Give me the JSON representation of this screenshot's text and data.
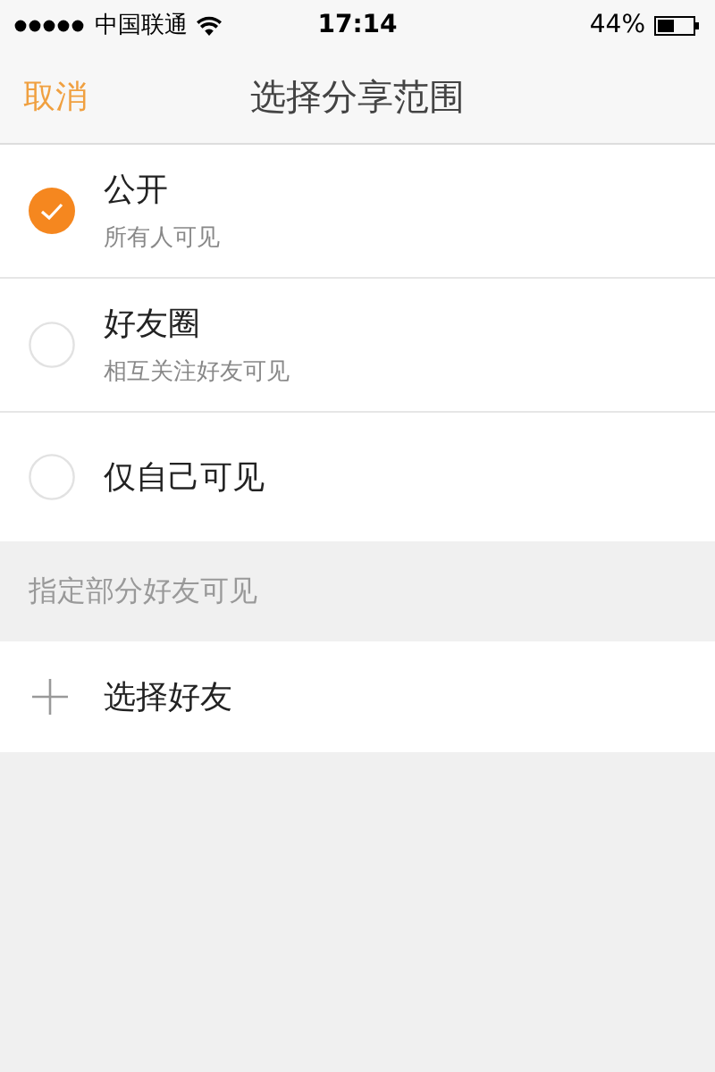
{
  "status_bar": {
    "carrier": "中国联通",
    "time": "17:14",
    "battery": "44%"
  },
  "nav_bar": {
    "cancel": "取消",
    "title": "选择分享范围"
  },
  "options": [
    {
      "label": "公开",
      "description": "所有人可见",
      "selected": true
    },
    {
      "label": "好友圈",
      "description": "相互关注好友可见",
      "selected": false
    },
    {
      "label": "仅自己可见",
      "selected": false
    }
  ],
  "section_header": "指定部分好友可见",
  "add_friends": {
    "label": "选择好友"
  }
}
